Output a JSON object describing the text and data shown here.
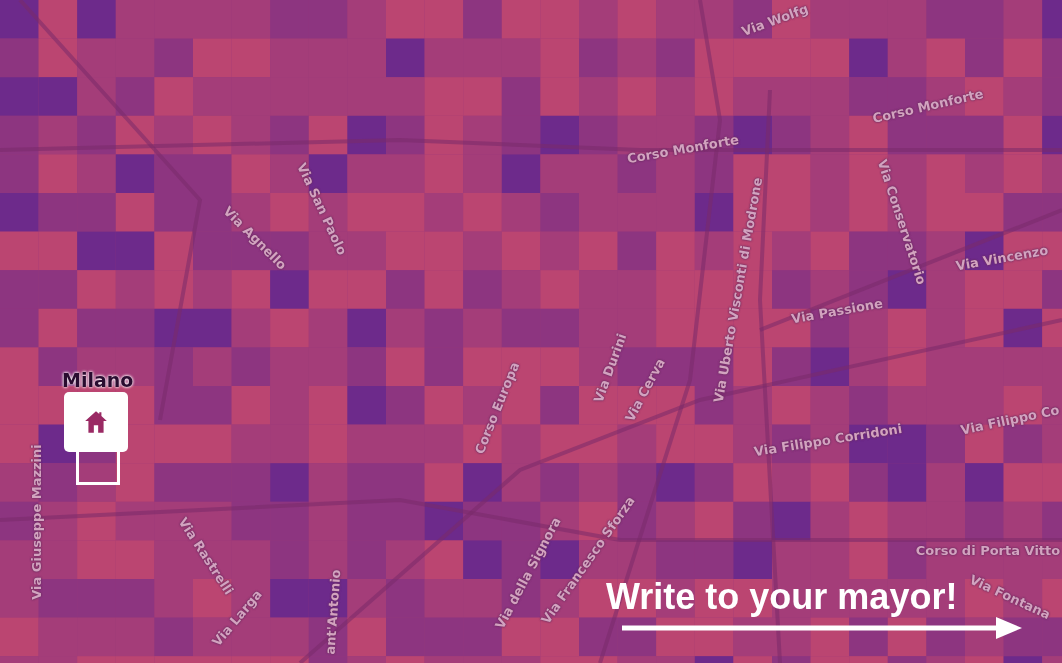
{
  "map": {
    "street_labels": [
      {
        "text": "Via Wolfg"
      },
      {
        "text": "Via Agnello"
      },
      {
        "text": "Via San Paolo"
      },
      {
        "text": "Corso Monforte"
      },
      {
        "text": "Corso Monforte"
      },
      {
        "text": "Via Uberto Visconti di Modrone"
      },
      {
        "text": "Via Conservatorio"
      },
      {
        "text": "Via Vincenzo"
      },
      {
        "text": "Via Passione"
      },
      {
        "text": "Via Giuseppe Mazzini"
      },
      {
        "text": "Corso Europa"
      },
      {
        "text": "Via Durini"
      },
      {
        "text": "Via Cerva"
      },
      {
        "text": "Via Rastrelli"
      },
      {
        "text": "Via Larga"
      },
      {
        "text": "ant'Antonio"
      },
      {
        "text": "Via della Signora"
      },
      {
        "text": "Via Francesco Sforza"
      },
      {
        "text": "Via Filippo Corridoni"
      },
      {
        "text": "Via Filippo Co"
      },
      {
        "text": "Corso di Porta Vitto"
      },
      {
        "text": "Via Fontana"
      }
    ],
    "marker": {
      "label": "Milano"
    }
  },
  "call_to_action": {
    "text": "Write to your mayor!"
  }
}
